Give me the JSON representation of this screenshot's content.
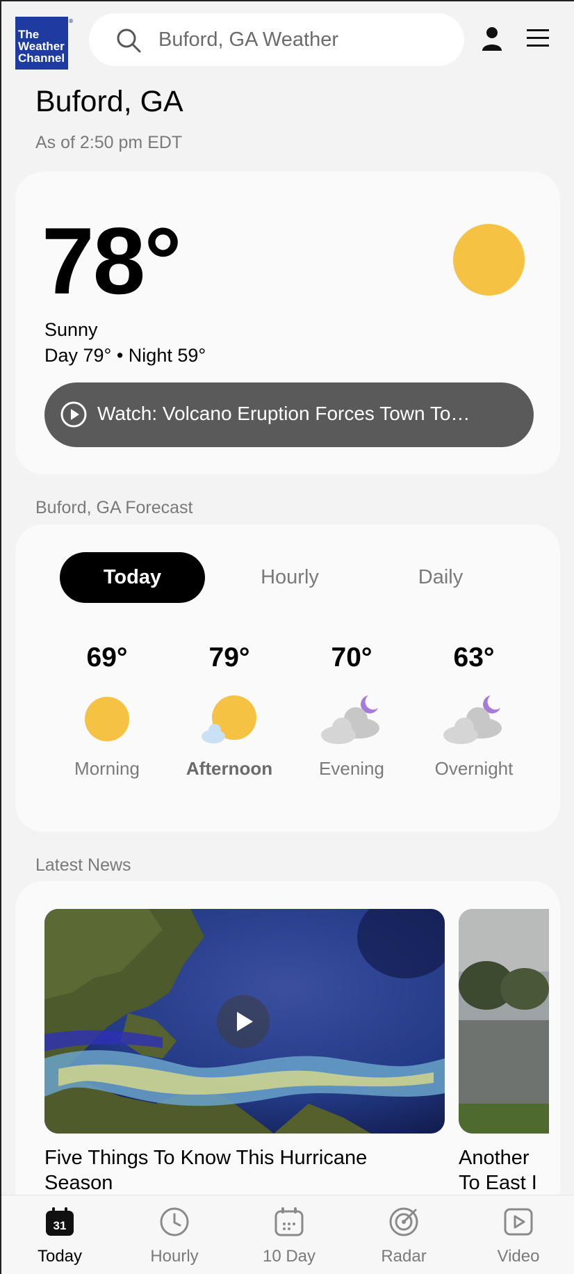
{
  "header": {
    "logo_lines": [
      "The",
      "Weather",
      "Channel"
    ],
    "search_placeholder": "Buford, GA Weather"
  },
  "location": {
    "title": "Buford, GA",
    "as_of": "As of 2:50 pm EDT"
  },
  "current": {
    "temp": "78°",
    "phrase": "Sunny",
    "day_night": "Day 79° • Night 59°",
    "icon": "sun-icon",
    "watch_text": "Watch: Volcano Eruption Forces Town To…"
  },
  "forecast": {
    "section_label": "Buford, GA Forecast",
    "tabs": [
      "Today",
      "Hourly",
      "Daily"
    ],
    "periods": [
      {
        "temp": "69°",
        "label": "Morning",
        "icon": "sun-icon"
      },
      {
        "temp": "79°",
        "label": "Afternoon",
        "icon": "mostly-sunny-icon"
      },
      {
        "temp": "70°",
        "label": "Evening",
        "icon": "partly-cloudy-night-icon"
      },
      {
        "temp": "63°",
        "label": "Overnight",
        "icon": "partly-cloudy-night-icon"
      }
    ]
  },
  "news": {
    "section_label": "Latest News",
    "items": [
      {
        "title": "Five Things To Know This Hurricane Season"
      },
      {
        "title": "Another\nTo East I"
      }
    ]
  },
  "nav": {
    "items": [
      {
        "label": "Today",
        "badge": "31",
        "icon": "calendar-today-icon"
      },
      {
        "label": "Hourly",
        "icon": "clock-icon"
      },
      {
        "label": "10 Day",
        "icon": "calendar-icon"
      },
      {
        "label": "Radar",
        "icon": "radar-icon"
      },
      {
        "label": "Video",
        "icon": "video-icon"
      }
    ]
  },
  "colors": {
    "brand_blue": "#1d3ba0",
    "sun_yellow": "#f6c244",
    "moon_purple": "#a779d8"
  }
}
